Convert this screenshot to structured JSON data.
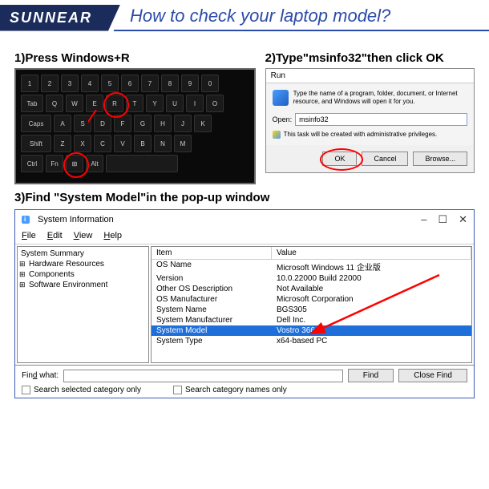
{
  "header": {
    "brand": "SUNNEAR",
    "title": "How to check your laptop model?"
  },
  "step1": {
    "label": "1)Press Windows+R"
  },
  "step2": {
    "label": "2)Type\"msinfo32\"then click OK",
    "run": {
      "title": "Run",
      "desc": "Type the name of a program, folder, document, or Internet resource, and Windows will open it for you.",
      "open_label": "Open:",
      "open_value": "msinfo32",
      "priv": "This task will be created with administrative privileges.",
      "ok": "OK",
      "cancel": "Cancel",
      "browse": "Browse..."
    }
  },
  "step3": {
    "label": "3)Find \"System Model\"in the pop-up window"
  },
  "sysinfo": {
    "title": "System Information",
    "menu": {
      "file": "File",
      "edit": "Edit",
      "view": "View",
      "help": "Help"
    },
    "tree": {
      "root": "System Summary",
      "items": [
        "Hardware Resources",
        "Components",
        "Software Environment"
      ]
    },
    "grid": {
      "col_item": "Item",
      "col_value": "Value",
      "rows": [
        {
          "item": "OS Name",
          "value": "Microsoft Windows 11 企业版"
        },
        {
          "item": "Version",
          "value": "10.0.22000 Build 22000"
        },
        {
          "item": "Other OS Description",
          "value": "Not Available"
        },
        {
          "item": "OS Manufacturer",
          "value": "Microsoft Corporation"
        },
        {
          "item": "System Name",
          "value": "BGS305"
        },
        {
          "item": "System Manufacturer",
          "value": "Dell Inc."
        },
        {
          "item": "System Model",
          "value": "Vostro 3669",
          "selected": true
        },
        {
          "item": "System Type",
          "value": "x64-based PC"
        }
      ]
    },
    "find": {
      "label": "Find what:",
      "find_btn": "Find",
      "close_btn": "Close Find",
      "chk1": "Search selected category only",
      "chk2": "Search category names only"
    }
  }
}
